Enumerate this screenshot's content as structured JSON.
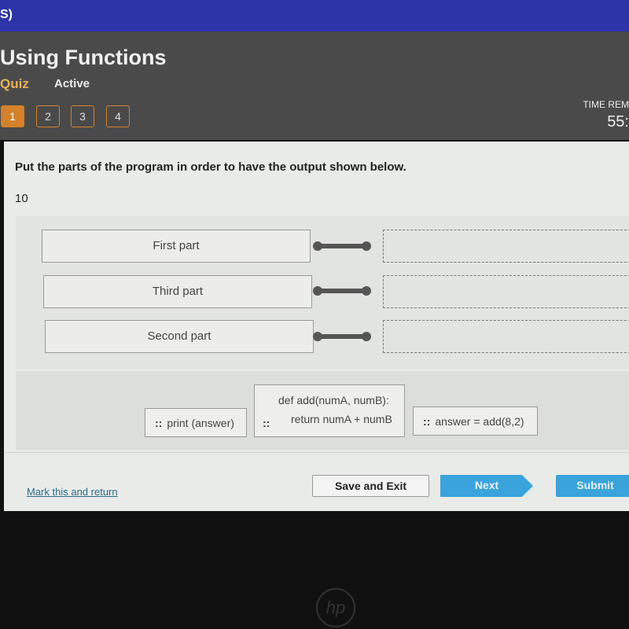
{
  "topbar": {
    "text": "S)"
  },
  "header": {
    "title": "Using Functions",
    "type": "Quiz",
    "status": "Active",
    "questions": [
      "1",
      "2",
      "3",
      "4"
    ],
    "current_question": "1",
    "time_label": "TIME REM",
    "time_value": "55:"
  },
  "question": {
    "prompt": "Put the parts of the program in order to have the output shown below.",
    "output": "10",
    "labels": [
      "First part",
      "Third part",
      "Second part"
    ],
    "tiles": {
      "print": "print (answer)",
      "def_line1": "def add(numA, numB):",
      "def_line2": "return numA + numB",
      "answer": "answer = add(8,2)"
    },
    "grip_glyph": "::"
  },
  "footer": {
    "mark": "Mark this and return",
    "save": "Save and Exit",
    "next": "Next",
    "submit": "Submit"
  },
  "bezel": {
    "logo": "hp"
  },
  "colors": {
    "accent_orange": "#d4822a",
    "button_blue": "#3aa3dc",
    "topbar": "#2c34a8"
  }
}
